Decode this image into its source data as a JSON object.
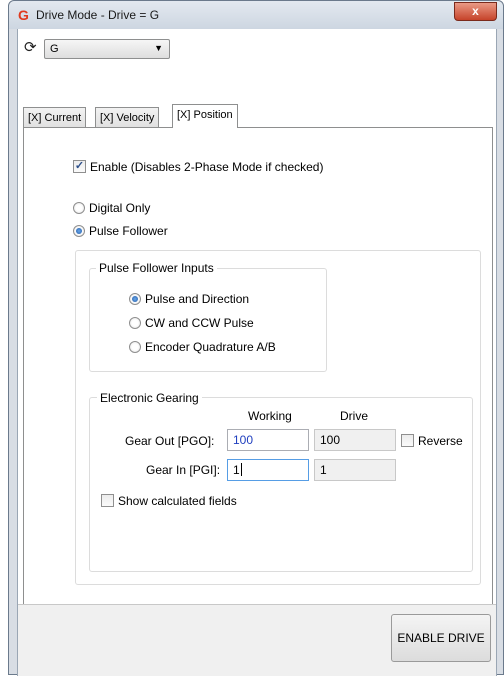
{
  "window": {
    "title": "Drive Mode - Drive = G",
    "app_icon": "G",
    "close_label": "x"
  },
  "toolbar": {
    "refresh_icon": "refresh-icon",
    "drive_select_value": "G"
  },
  "tabs": [
    {
      "label": "[X] Current",
      "active": false
    },
    {
      "label": "[X] Velocity",
      "active": false
    },
    {
      "label": "[X] Position",
      "active": true
    }
  ],
  "position_tab": {
    "enable": {
      "label": "Enable (Disables 2-Phase Mode if checked)",
      "checked": true
    },
    "mode_options": [
      {
        "label": "Digital Only",
        "selected": false
      },
      {
        "label": "Pulse Follower",
        "selected": true
      }
    ],
    "pulse_follower_inputs": {
      "legend": "Pulse Follower Inputs",
      "options": [
        {
          "label": "Pulse and Direction",
          "selected": true
        },
        {
          "label": "CW and CCW Pulse",
          "selected": false
        },
        {
          "label": "Encoder Quadrature A/B",
          "selected": false
        }
      ]
    },
    "electronic_gearing": {
      "legend": "Electronic Gearing",
      "col_working": "Working",
      "col_drive": "Drive",
      "gear_out_label": "Gear Out [PGO]:",
      "gear_out_working": "100",
      "gear_out_drive": "100",
      "gear_in_label": "Gear In [PGI]:",
      "gear_in_working": "1",
      "gear_in_drive": "1",
      "reverse": {
        "label": "Reverse",
        "checked": false
      },
      "show_calculated": {
        "label": "Show calculated fields",
        "checked": false
      }
    }
  },
  "footer": {
    "enable_drive_label": "ENABLE DRIVE"
  },
  "colors": {
    "accent_text": "#1f3fbf",
    "app_icon": "#e03a1e"
  }
}
